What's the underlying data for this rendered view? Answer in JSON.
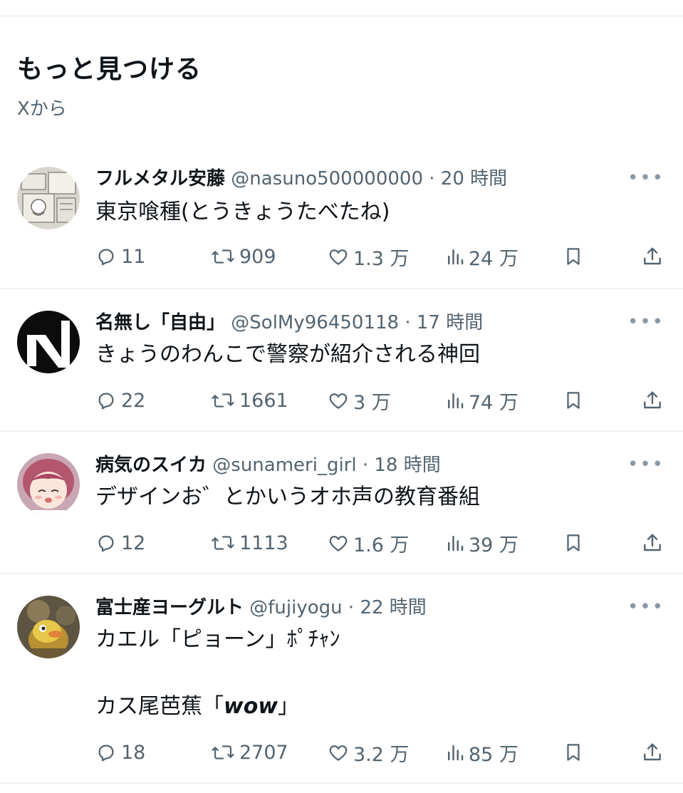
{
  "section": {
    "title": "もっと見つける",
    "subtitle": "Xから"
  },
  "icons": {
    "more": "more-horizontal-icon",
    "reply": "reply-icon",
    "repost": "repost-icon",
    "like": "heart-icon",
    "views": "views-chart-icon",
    "bookmark": "bookmark-icon",
    "share": "share-icon"
  },
  "colors": {
    "text": "#0f1419",
    "secondary": "#536471",
    "divider": "#eff3f4"
  },
  "posts": [
    {
      "name": "フルメタル安藤",
      "handle": "@nasuno500000000",
      "time": "20 時間",
      "text": [
        "東京喰種(とうきょうたべたね)"
      ],
      "replies": "11",
      "reposts": "909",
      "likes": "1.3 万",
      "views": "24 万"
    },
    {
      "name": "名無し「自由」",
      "handle": "@SolMy96450118",
      "time": "17 時間",
      "text": [
        "きょうのわんこで警察が紹介される神回"
      ],
      "replies": "22",
      "reposts": "1661",
      "likes": "3 万",
      "views": "74 万"
    },
    {
      "name": "病気のスイカ",
      "handle": "@sunameri_girl",
      "time": "18 時間",
      "text": [
        "デザインお゛とかいうオホ声の教育番組"
      ],
      "replies": "12",
      "reposts": "1113",
      "likes": "1.6 万",
      "views": "39 万"
    },
    {
      "name": "富士産ヨーグルト",
      "handle": "@fujiyogu",
      "time": "22 時間",
      "text": [
        "カエル「ピョーン」ﾎﾟﾁｬﾝ",
        "カス尾芭蕉「",
        "wow",
        "」"
      ],
      "replies": "18",
      "reposts": "2707",
      "likes": "3.2 万",
      "views": "85 万"
    }
  ]
}
